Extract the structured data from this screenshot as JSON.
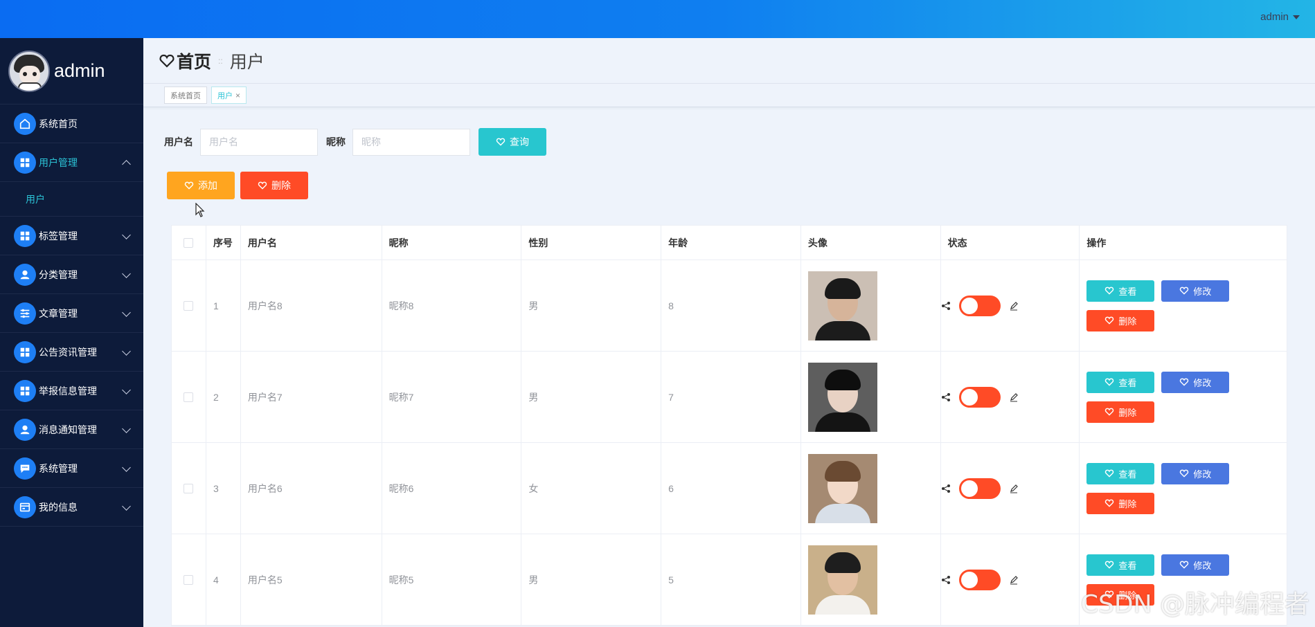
{
  "topbar": {
    "admin_label": "admin"
  },
  "sidebar": {
    "username": "admin",
    "items": [
      {
        "label": "系统首页",
        "icon": "home-icon",
        "expanded": null
      },
      {
        "label": "用户管理",
        "icon": "grid-icon",
        "expanded": true,
        "active": true,
        "children": [
          {
            "label": "用户"
          }
        ]
      },
      {
        "label": "标签管理",
        "icon": "grid-icon",
        "expanded": false
      },
      {
        "label": "分类管理",
        "icon": "user-icon",
        "expanded": false
      },
      {
        "label": "文章管理",
        "icon": "sliders-icon",
        "expanded": false
      },
      {
        "label": "公告资讯管理",
        "icon": "grid-icon",
        "expanded": false
      },
      {
        "label": "举报信息管理",
        "icon": "grid-icon",
        "expanded": false
      },
      {
        "label": "消息通知管理",
        "icon": "user-icon",
        "expanded": false
      },
      {
        "label": "系统管理",
        "icon": "chat-icon",
        "expanded": false
      },
      {
        "label": "我的信息",
        "icon": "card-icon",
        "expanded": false
      }
    ]
  },
  "breadcrumb": {
    "home": "首页",
    "separator": "::",
    "current": "用户"
  },
  "tabs": [
    {
      "label": "系统首页",
      "active": false
    },
    {
      "label": "用户",
      "active": true,
      "close": "×"
    }
  ],
  "search": {
    "username_label": "用户名",
    "username_placeholder": "用户名",
    "nickname_label": "昵称",
    "nickname_placeholder": "昵称",
    "query_label": "查询"
  },
  "actions": {
    "add_label": "添加",
    "delete_label": "删除"
  },
  "table": {
    "headers": {
      "index": "序号",
      "username": "用户名",
      "nickname": "昵称",
      "gender": "性别",
      "age": "年龄",
      "photo": "头像",
      "status": "状态",
      "ops": "操作"
    },
    "rows": [
      {
        "index": "1",
        "username": "用户名8",
        "nickname": "昵称8",
        "gender": "男",
        "age": "8"
      },
      {
        "index": "2",
        "username": "用户名7",
        "nickname": "昵称7",
        "gender": "男",
        "age": "7"
      },
      {
        "index": "3",
        "username": "用户名6",
        "nickname": "昵称6",
        "gender": "女",
        "age": "6"
      },
      {
        "index": "4",
        "username": "用户名5",
        "nickname": "昵称5",
        "gender": "男",
        "age": "5"
      }
    ],
    "row_buttons": {
      "view": "查看",
      "edit": "修改",
      "delete": "删除"
    }
  },
  "watermark": "CSDN @脉冲编程者",
  "colors": {
    "topbar_start": "#0a6cf2",
    "topbar_end": "#23b5e6",
    "sidebar": "#0d1b3a",
    "accent_cyan": "#28c6cf",
    "add": "#ffa51f",
    "danger": "#ff4b26",
    "edit": "#4a77e0"
  }
}
